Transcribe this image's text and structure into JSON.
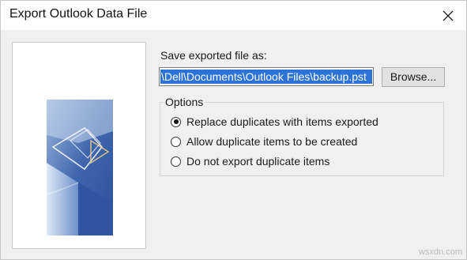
{
  "window": {
    "title": "Export Outlook Data File"
  },
  "form": {
    "save_label": "Save exported file as:",
    "path_value": "\\Dell\\Documents\\Outlook Files\\backup.pst",
    "browse_label": "Browse..."
  },
  "options": {
    "legend": "Options",
    "items": [
      {
        "label": "Replace duplicates with items exported",
        "checked": true
      },
      {
        "label": "Allow duplicate items to be created",
        "checked": false
      },
      {
        "label": "Do not export duplicate items",
        "checked": false
      }
    ]
  },
  "watermark": "wsxdn.com",
  "colors": {
    "selection": "#2b73d7",
    "dialog_bg": "#f0f0f0"
  }
}
